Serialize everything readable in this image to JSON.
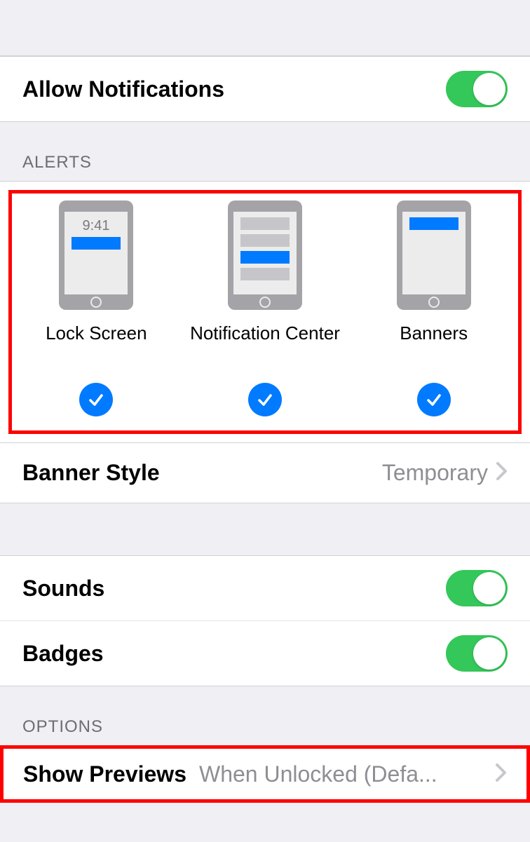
{
  "allowNotifications": {
    "label": "Allow Notifications",
    "enabled": true
  },
  "sections": {
    "alerts": {
      "header": "ALERTS",
      "items": [
        {
          "label": "Lock Screen",
          "checked": true,
          "timeText": "9:41"
        },
        {
          "label": "Notification Center",
          "checked": true
        },
        {
          "label": "Banners",
          "checked": true
        }
      ]
    },
    "options": {
      "header": "OPTIONS"
    }
  },
  "bannerStyle": {
    "label": "Banner Style",
    "value": "Temporary"
  },
  "sounds": {
    "label": "Sounds",
    "enabled": true
  },
  "badges": {
    "label": "Badges",
    "enabled": true
  },
  "showPreviews": {
    "label": "Show Previews",
    "value": "When Unlocked (Defa..."
  },
  "colors": {
    "accent": "#007aff",
    "toggleOn": "#34c759",
    "highlight": "#ff0000"
  }
}
